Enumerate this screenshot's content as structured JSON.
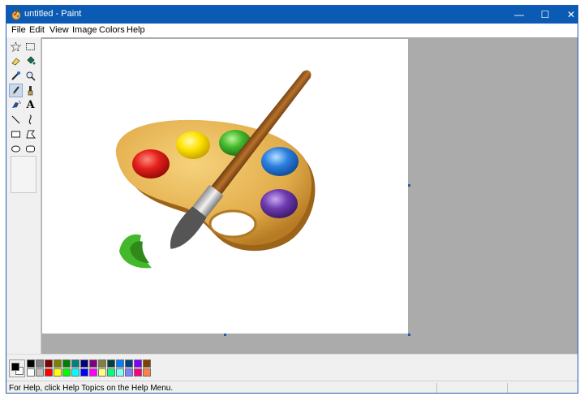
{
  "window": {
    "title": "untitled - Paint",
    "controls": {
      "minimize": "—",
      "maximize": "☐",
      "close": "✕"
    }
  },
  "menu": [
    "File",
    "Edit",
    "View",
    "Image",
    "Colors",
    "Help"
  ],
  "tools": [
    "free-form-select",
    "select",
    "eraser",
    "fill-with-color",
    "pick-color",
    "magnifier",
    "pencil",
    "brush",
    "airbrush",
    "text",
    "line",
    "curve",
    "rectangle",
    "polygon",
    "ellipse",
    "rounded-rectangle"
  ],
  "selected_tool": "pencil",
  "text_tool_glyph": "A",
  "canvas": {
    "image": "paint-palette-and-brush-illustration"
  },
  "colors": {
    "foreground": "#000000",
    "background": "#ffffff",
    "palette_row1": [
      "#000000",
      "#808080",
      "#800000",
      "#808000",
      "#008000",
      "#008080",
      "#000080",
      "#800080",
      "#808040",
      "#004040",
      "#0080ff",
      "#004080",
      "#8000ff",
      "#804000"
    ],
    "palette_row2": [
      "#ffffff",
      "#c0c0c0",
      "#ff0000",
      "#ffff00",
      "#00ff00",
      "#00ffff",
      "#0000ff",
      "#ff00ff",
      "#ffff80",
      "#00ff80",
      "#80ffff",
      "#8080ff",
      "#ff0080",
      "#ff8040"
    ],
    "titlebar": "#0b5bb4",
    "workspace": "#ababab"
  },
  "status": {
    "text": "For Help, click Help Topics on the Help Menu."
  }
}
